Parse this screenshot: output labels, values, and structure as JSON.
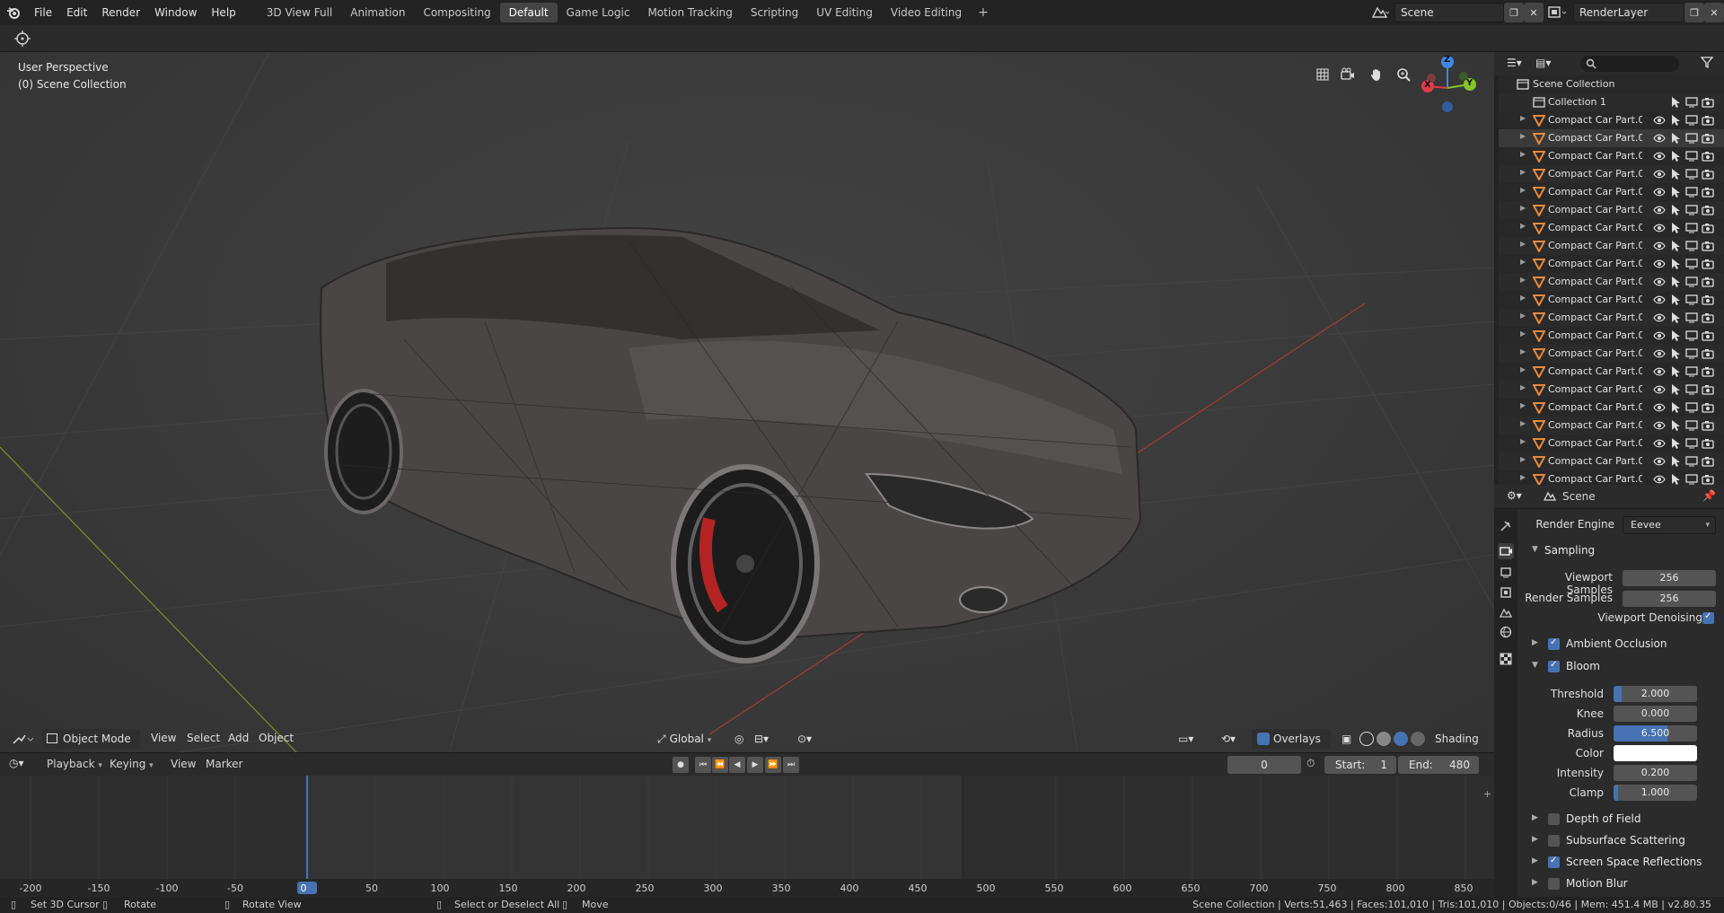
{
  "menu": [
    "File",
    "Edit",
    "Render",
    "Window",
    "Help"
  ],
  "workspaces": [
    {
      "label": "3D View Full",
      "active": false
    },
    {
      "label": "Animation",
      "active": false
    },
    {
      "label": "Compositing",
      "active": false
    },
    {
      "label": "Default",
      "active": true
    },
    {
      "label": "Game Logic",
      "active": false
    },
    {
      "label": "Motion Tracking",
      "active": false
    },
    {
      "label": "Scripting",
      "active": false
    },
    {
      "label": "UV Editing",
      "active": false
    },
    {
      "label": "Video Editing",
      "active": false
    }
  ],
  "workspace_add": "+",
  "scene_name": "Scene",
  "view_layer": "RenderLayer",
  "viewport": {
    "perspective": "User Perspective",
    "collection": "(0) Scene Collection",
    "axes": {
      "x": "X",
      "y": "Y",
      "z": "Z"
    },
    "mode": "Object Mode",
    "menus": [
      "View",
      "Select",
      "Add",
      "Object"
    ],
    "transform_orientation": "Global",
    "overlays_label": "Overlays",
    "shading_label": "Shading"
  },
  "timeline": {
    "menus": [
      "Playback",
      "Keying",
      "View",
      "Marker"
    ],
    "current_frame": "0",
    "start_label": "Start:",
    "start_value": "1",
    "end_label": "End:",
    "end_value": "480",
    "ticks": [
      "-200",
      "-150",
      "-100",
      "-50",
      "0",
      "50",
      "100",
      "150",
      "200",
      "250",
      "300",
      "350",
      "400",
      "450",
      "500",
      "550",
      "600",
      "650",
      "700",
      "750",
      "800",
      "850"
    ]
  },
  "statusbar": {
    "set_cursor": "Set 3D Cursor",
    "rotate": "Rotate",
    "rotate_view": "Rotate View",
    "select": "Select or Deselect All",
    "move": "Move",
    "stats": "Scene Collection | Verts:51,463 | Faces:101,010 | Tris:101,010 | Objects:0/46 | Mem: 451.4 MB | v2.80.35"
  },
  "outliner": {
    "root": "Scene Collection",
    "collection": "Collection 1",
    "items": [
      "Compact Car Part.0(",
      "Compact Car Part.0(",
      "Compact Car Part.0(",
      "Compact Car Part.0(",
      "Compact Car Part.0",
      "Compact Car Part.0",
      "Compact Car Part.0",
      "Compact Car Part.0",
      "Compact Car Part.0",
      "Compact Car Part.0",
      "Compact Car Part.0:",
      "Compact Car Part.0:",
      "Compact Car Part.0:",
      "Compact Car Part.0:",
      "Compact Car Part.0:",
      "Compact Car Part.0:",
      "Compact Car Part.0:",
      "Compact Car Part.0:",
      "Compact Car Part.0:",
      "Compact Car Part.0:",
      "Compact Car Part.0("
    ]
  },
  "properties": {
    "context": "Scene",
    "render_engine_label": "Render Engine",
    "render_engine": "Eevee",
    "sampling": "Sampling",
    "viewport_samples_label": "Viewport Samples",
    "viewport_samples": "256",
    "render_samples_label": "Render Samples",
    "render_samples": "256",
    "viewport_denoising": "Viewport Denoising",
    "ambient_occlusion": "Ambient Occlusion",
    "bloom": "Bloom",
    "threshold_label": "Threshold",
    "threshold": "2.000",
    "threshold_fill": 0.1,
    "knee_label": "Knee",
    "knee": "0.000",
    "radius_label": "Radius",
    "radius": "6.500",
    "radius_fill": 0.65,
    "color_label": "Color",
    "intensity_label": "Intensity",
    "intensity": "0.200",
    "clamp_label": "Clamp",
    "clamp": "1.000",
    "clamp_fill": 0.05,
    "depth_of_field": "Depth of Field",
    "subsurface_scattering": "Subsurface Scattering",
    "ssr": "Screen Space Reflections",
    "motion_blur": "Motion Blur"
  },
  "colors": {
    "accent": "#4772b3",
    "x_axis": "#e3394a",
    "y_axis": "#86c42a",
    "z_axis": "#3f86e8",
    "object_icon": "#e9893a"
  }
}
